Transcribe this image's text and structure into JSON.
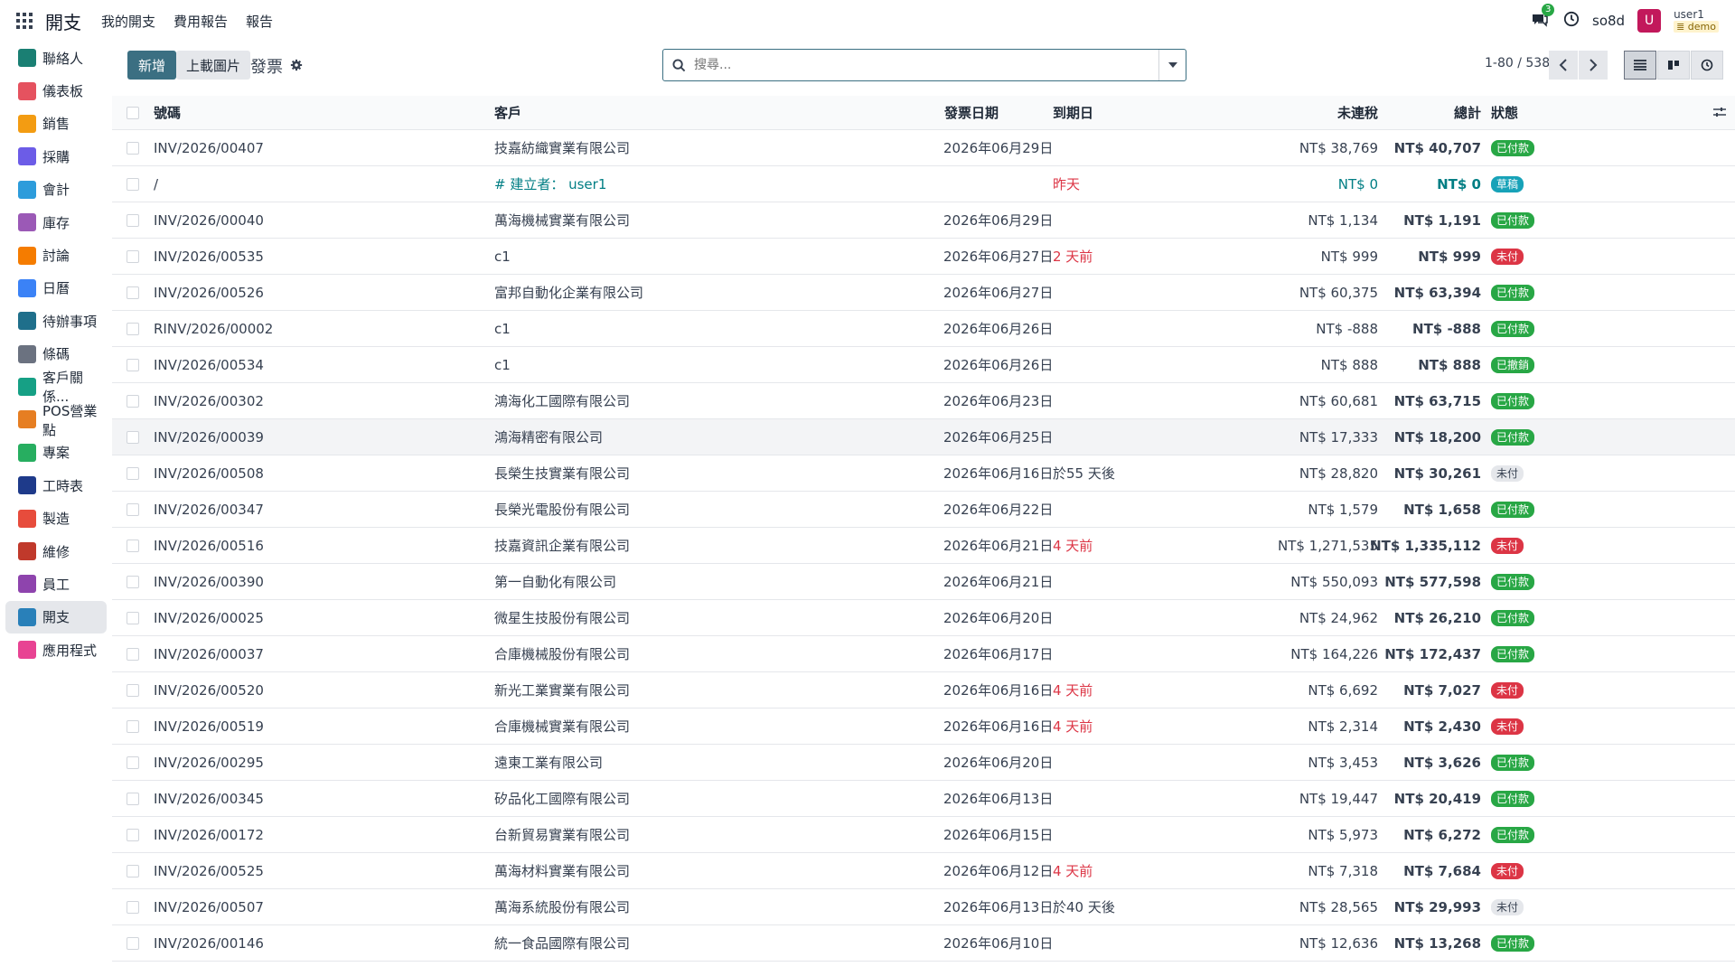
{
  "app": {
    "name": "開支",
    "menu": [
      "我的開支",
      "費用報告",
      "報告"
    ]
  },
  "topbar": {
    "chat_count": "3",
    "company": "so8d",
    "avatar_letter": "U",
    "user": "user1",
    "db": "demo"
  },
  "sidebar": [
    {
      "label": "聯絡人",
      "icon": "contacts-icon",
      "color": "#1a7f73"
    },
    {
      "label": "儀表板",
      "icon": "dashboard-icon",
      "color": "#e5525f"
    },
    {
      "label": "銷售",
      "icon": "sales-icon",
      "color": "#f39c12"
    },
    {
      "label": "採購",
      "icon": "purchase-icon",
      "color": "#6c5ce7"
    },
    {
      "label": "會計",
      "icon": "accounting-icon",
      "color": "#2d9cdb"
    },
    {
      "label": "庫存",
      "icon": "inventory-icon",
      "color": "#9b59b6"
    },
    {
      "label": "討論",
      "icon": "discuss-icon",
      "color": "#f57c00"
    },
    {
      "label": "日曆",
      "icon": "calendar-icon",
      "color": "#3b82f6"
    },
    {
      "label": "待辦事項",
      "icon": "todo-icon",
      "color": "#1f6f8b"
    },
    {
      "label": "條碼",
      "icon": "barcode-icon",
      "color": "#6b7280"
    },
    {
      "label": "客戶關係...",
      "icon": "crm-icon",
      "color": "#16a085"
    },
    {
      "label": "POS營業點",
      "icon": "pos-icon",
      "color": "#e67e22"
    },
    {
      "label": "專案",
      "icon": "project-icon",
      "color": "#27ae60"
    },
    {
      "label": "工時表",
      "icon": "timesheet-icon",
      "color": "#1e3a8a"
    },
    {
      "label": "製造",
      "icon": "manufacturing-icon",
      "color": "#e74c3c"
    },
    {
      "label": "維修",
      "icon": "repair-icon",
      "color": "#c0392b"
    },
    {
      "label": "員工",
      "icon": "employees-icon",
      "color": "#8e44ad"
    },
    {
      "label": "開支",
      "icon": "expenses-icon",
      "color": "#2980b9",
      "active": true
    },
    {
      "label": "應用程式",
      "icon": "apps-icon",
      "color": "#e84393"
    }
  ],
  "control": {
    "new_label": "新增",
    "upload_label": "上載圖片",
    "breadcrumb": "發票",
    "search_placeholder": "搜尋...",
    "pager": "1-80 / 538"
  },
  "table": {
    "headers": {
      "number": "號碼",
      "customer": "客戶",
      "invoice_date": "發票日期",
      "due_date": "到期日",
      "untaxed": "未連稅",
      "total": "總計",
      "status": "狀態"
    },
    "rows": [
      {
        "number": "INV/2026/00407",
        "customer": "技嘉紡織實業有限公司",
        "date": "2026年06月29日",
        "due": "",
        "untaxed": "NT$ 38,769",
        "total": "NT$ 40,707",
        "status": "已付款",
        "status_type": "paid"
      },
      {
        "number": "/",
        "customer": "# 建立者： user1",
        "date": "",
        "due": "昨天",
        "untaxed": "NT$ 0",
        "total": "NT$ 0",
        "status": "草稿",
        "status_type": "draft",
        "draft": true
      },
      {
        "number": "INV/2026/00040",
        "customer": "萬海機械實業有限公司",
        "date": "2026年06月29日",
        "due": "",
        "untaxed": "NT$ 1,134",
        "total": "NT$ 1,191",
        "status": "已付款",
        "status_type": "paid"
      },
      {
        "number": "INV/2026/00535",
        "customer": "c1",
        "date": "2026年06月27日",
        "due": "2 天前",
        "untaxed": "NT$ 999",
        "total": "NT$ 999",
        "status": "未付",
        "status_type": "unpaid"
      },
      {
        "number": "INV/2026/00526",
        "customer": "富邦自動化企業有限公司",
        "date": "2026年06月27日",
        "due": "",
        "untaxed": "NT$ 60,375",
        "total": "NT$ 63,394",
        "status": "已付款",
        "status_type": "paid"
      },
      {
        "number": "RINV/2026/00002",
        "customer": "c1",
        "date": "2026年06月26日",
        "due": "",
        "untaxed": "NT$ -888",
        "total": "NT$ -888",
        "status": "已付款",
        "status_type": "paid"
      },
      {
        "number": "INV/2026/00534",
        "customer": "c1",
        "date": "2026年06月26日",
        "due": "",
        "untaxed": "NT$ 888",
        "total": "NT$ 888",
        "status": "已撤銷",
        "status_type": "paid"
      },
      {
        "number": "INV/2026/00302",
        "customer": "鴻海化工國際有限公司",
        "date": "2026年06月23日",
        "due": "",
        "untaxed": "NT$ 60,681",
        "total": "NT$ 63,715",
        "status": "已付款",
        "status_type": "paid"
      },
      {
        "number": "INV/2026/00039",
        "customer": "鴻海精密有限公司",
        "date": "2026年06月25日",
        "due": "",
        "untaxed": "NT$ 17,333",
        "total": "NT$ 18,200",
        "status": "已付款",
        "status_type": "paid",
        "hover": true
      },
      {
        "number": "INV/2026/00508",
        "customer": "長榮生技實業有限公司",
        "date": "2026年06月16日",
        "due": "於55 天後",
        "due_normal": true,
        "untaxed": "NT$ 28,820",
        "total": "NT$ 30,261",
        "status": "未付",
        "status_type": "pending"
      },
      {
        "number": "INV/2026/00347",
        "customer": "長榮光電股份有限公司",
        "date": "2026年06月22日",
        "due": "",
        "untaxed": "NT$ 1,579",
        "total": "NT$ 1,658",
        "status": "已付款",
        "status_type": "paid"
      },
      {
        "number": "INV/2026/00516",
        "customer": "技嘉資訊企業有限公司",
        "date": "2026年06月21日",
        "due": "4 天前",
        "untaxed": "NT$ 1,271,535",
        "total": "NT$ 1,335,112",
        "status": "未付",
        "status_type": "unpaid"
      },
      {
        "number": "INV/2026/00390",
        "customer": "第一自動化有限公司",
        "date": "2026年06月21日",
        "due": "",
        "untaxed": "NT$ 550,093",
        "total": "NT$ 577,598",
        "status": "已付款",
        "status_type": "paid"
      },
      {
        "number": "INV/2026/00025",
        "customer": "微星生技股份有限公司",
        "date": "2026年06月20日",
        "due": "",
        "untaxed": "NT$ 24,962",
        "total": "NT$ 26,210",
        "status": "已付款",
        "status_type": "paid"
      },
      {
        "number": "INV/2026/00037",
        "customer": "合庫機械股份有限公司",
        "date": "2026年06月17日",
        "due": "",
        "untaxed": "NT$ 164,226",
        "total": "NT$ 172,437",
        "status": "已付款",
        "status_type": "paid"
      },
      {
        "number": "INV/2026/00520",
        "customer": "新光工業實業有限公司",
        "date": "2026年06月16日",
        "due": "4 天前",
        "untaxed": "NT$ 6,692",
        "total": "NT$ 7,027",
        "status": "未付",
        "status_type": "unpaid"
      },
      {
        "number": "INV/2026/00519",
        "customer": "合庫機械實業有限公司",
        "date": "2026年06月16日",
        "due": "4 天前",
        "untaxed": "NT$ 2,314",
        "total": "NT$ 2,430",
        "status": "未付",
        "status_type": "unpaid"
      },
      {
        "number": "INV/2026/00295",
        "customer": "遠東工業有限公司",
        "date": "2026年06月20日",
        "due": "",
        "untaxed": "NT$ 3,453",
        "total": "NT$ 3,626",
        "status": "已付款",
        "status_type": "paid"
      },
      {
        "number": "INV/2026/00345",
        "customer": "矽品化工國際有限公司",
        "date": "2026年06月13日",
        "due": "",
        "untaxed": "NT$ 19,447",
        "total": "NT$ 20,419",
        "status": "已付款",
        "status_type": "paid"
      },
      {
        "number": "INV/2026/00172",
        "customer": "台新貿易實業有限公司",
        "date": "2026年06月15日",
        "due": "",
        "untaxed": "NT$ 5,973",
        "total": "NT$ 6,272",
        "status": "已付款",
        "status_type": "paid"
      },
      {
        "number": "INV/2026/00525",
        "customer": "萬海材料實業有限公司",
        "date": "2026年06月12日",
        "due": "4 天前",
        "untaxed": "NT$ 7,318",
        "total": "NT$ 7,684",
        "status": "未付",
        "status_type": "unpaid"
      },
      {
        "number": "INV/2026/00507",
        "customer": "萬海系統股份有限公司",
        "date": "2026年06月13日",
        "due": "於40 天後",
        "due_normal": true,
        "untaxed": "NT$ 28,565",
        "total": "NT$ 29,993",
        "status": "未付",
        "status_type": "pending"
      },
      {
        "number": "INV/2026/00146",
        "customer": "統一食品國際有限公司",
        "date": "2026年06月10日",
        "due": "",
        "untaxed": "NT$ 12,636",
        "total": "NT$ 13,268",
        "status": "已付款",
        "status_type": "paid"
      }
    ]
  }
}
